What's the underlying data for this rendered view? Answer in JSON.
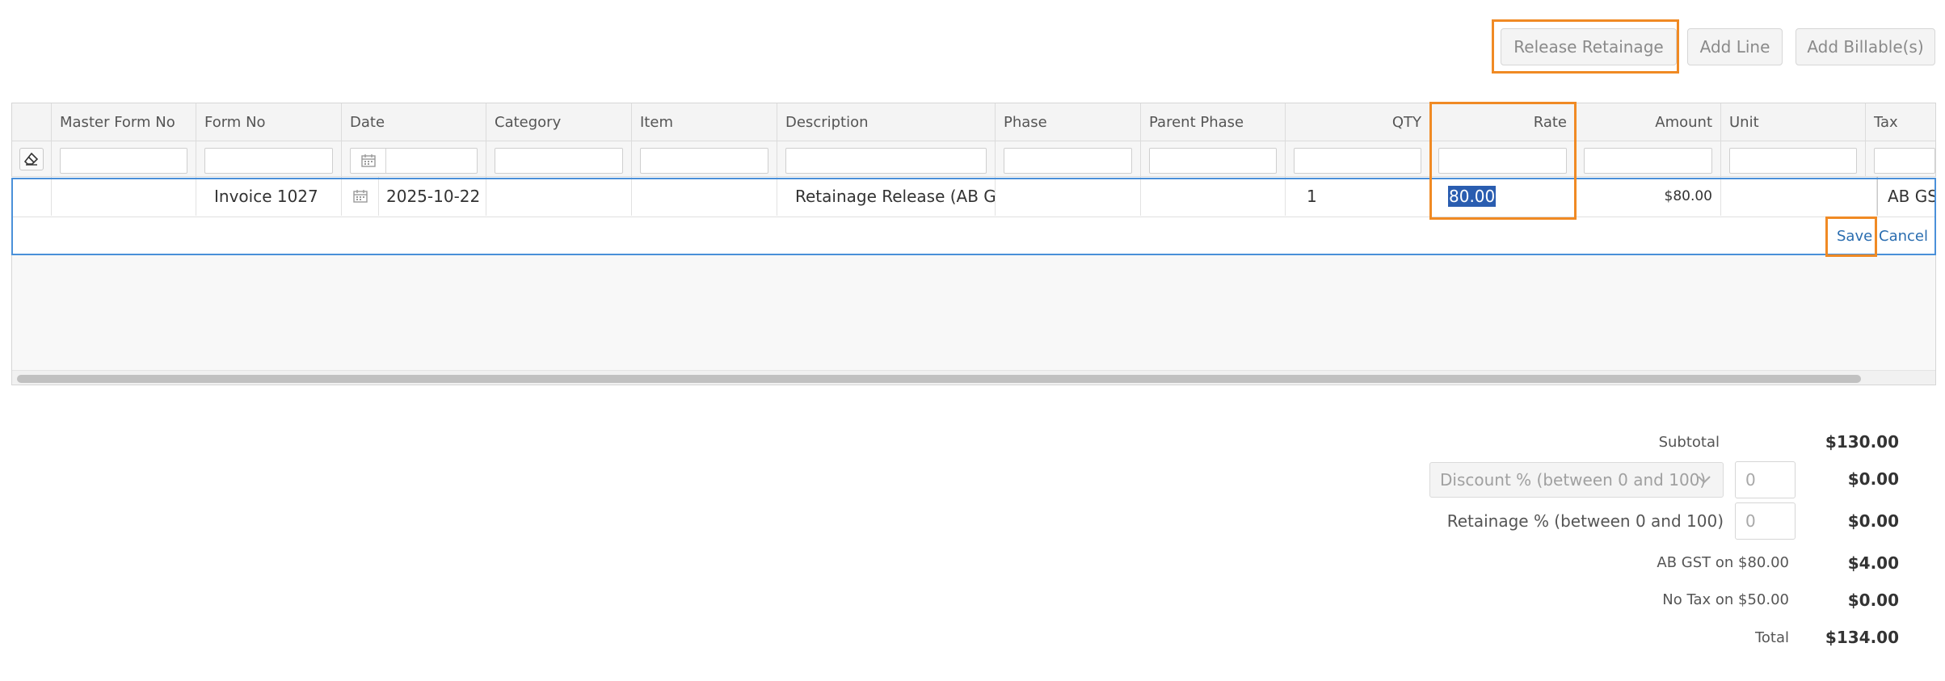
{
  "toolbar": {
    "release_retainage": "Release Retainage",
    "add_line": "Add Line",
    "add_billables": "Add Billable(s)"
  },
  "grid": {
    "columns": {
      "master_form_no": "Master Form No",
      "form_no": "Form No",
      "date": "Date",
      "category": "Category",
      "item": "Item",
      "description": "Description",
      "phase": "Phase",
      "parent_phase": "Parent Phase",
      "qty": "QTY",
      "rate": "Rate",
      "amount": "Amount",
      "unit": "Unit",
      "tax": "Tax"
    },
    "edit_row": {
      "form_no": "Invoice 1027",
      "date": "2025-10-22",
      "description": "Retainage Release (AB GS",
      "qty": "1",
      "rate": "80.00",
      "amount": "$80.00",
      "tax": "AB GST"
    },
    "actions": {
      "save": "Save",
      "cancel": "Cancel"
    }
  },
  "totals": {
    "subtotal_label": "Subtotal",
    "subtotal_value": "$130.00",
    "discount_placeholder": "Discount % (between 0 and 100)",
    "discount_input": "0",
    "discount_value": "$0.00",
    "retainage_label": "Retainage % (between 0 and 100)",
    "retainage_input": "0",
    "retainage_value": "$0.00",
    "tax1_label": "AB GST on $80.00",
    "tax1_value": "$4.00",
    "tax2_label": "No Tax on $50.00",
    "tax2_value": "$0.00",
    "total_label": "Total",
    "total_value": "$134.00"
  },
  "colors": {
    "highlight": "#f08a24",
    "selection": "#4a90d9",
    "link": "#2a6db0"
  }
}
